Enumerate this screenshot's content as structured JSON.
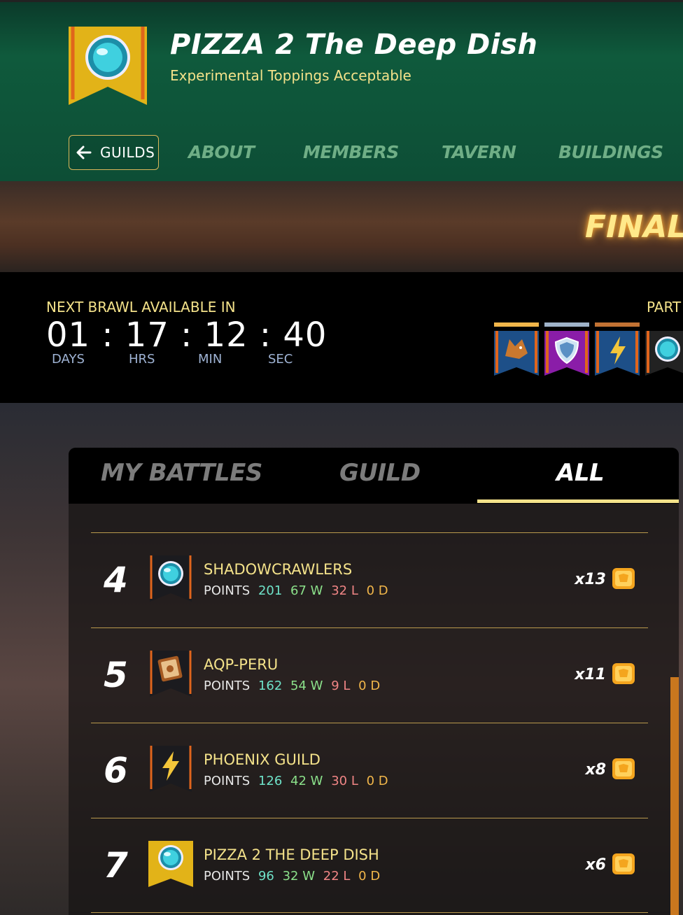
{
  "header": {
    "guild_name": "PIZZA 2 The Deep Dish",
    "motto": "Experimental Toppings Acceptable",
    "back_label": "GUILDS",
    "nav": [
      "ABOUT",
      "MEMBERS",
      "TAVERN",
      "BUILDINGS"
    ]
  },
  "hero": {
    "title": "FINAL I"
  },
  "timer": {
    "label": "NEXT BRAWL AVAILABLE IN",
    "days": "01",
    "hrs": "17",
    "min": "12",
    "sec": "40",
    "units": [
      "DAYS",
      "HRS",
      "MIN",
      "SEC"
    ],
    "sep": ":"
  },
  "participants": {
    "label": "PART",
    "banners": [
      "wolf-crest-icon",
      "shield-crest-icon",
      "lightning-crest-icon",
      "orb-crest-icon"
    ],
    "bar_colors": [
      "#f1b64a",
      "#9fb3c9",
      "#c27233"
    ]
  },
  "tabs": {
    "my_battles": "MY BATTLES",
    "guild": "GUILD",
    "all": "ALL"
  },
  "rows": [
    {
      "rank": "4",
      "name": "SHADOWCRAWLERS",
      "points_label": "POINTS",
      "points": "201",
      "wins": "67 W",
      "losses": "32 L",
      "draws": "0 D",
      "multiplier": "x13",
      "banner": "orb"
    },
    {
      "rank": "5",
      "name": "AQP-PERU",
      "points_label": "POINTS",
      "points": "162",
      "wins": "54 W",
      "losses": "9 L",
      "draws": "0 D",
      "multiplier": "x11",
      "banner": "book"
    },
    {
      "rank": "6",
      "name": "PHOENIX GUILD",
      "points_label": "POINTS",
      "points": "126",
      "wins": "42 W",
      "losses": "30 L",
      "draws": "0 D",
      "multiplier": "x8",
      "banner": "lightning"
    },
    {
      "rank": "7",
      "name": "PIZZA 2 THE DEEP DISH",
      "points_label": "POINTS",
      "points": "96",
      "wins": "32 W",
      "losses": "22 L",
      "draws": "0 D",
      "multiplier": "x6",
      "banner": "gold-orb"
    }
  ],
  "colors": {
    "accent": "#f4e28a",
    "header_green": "#0f5a3c",
    "scrollbar": "#c9771e"
  }
}
